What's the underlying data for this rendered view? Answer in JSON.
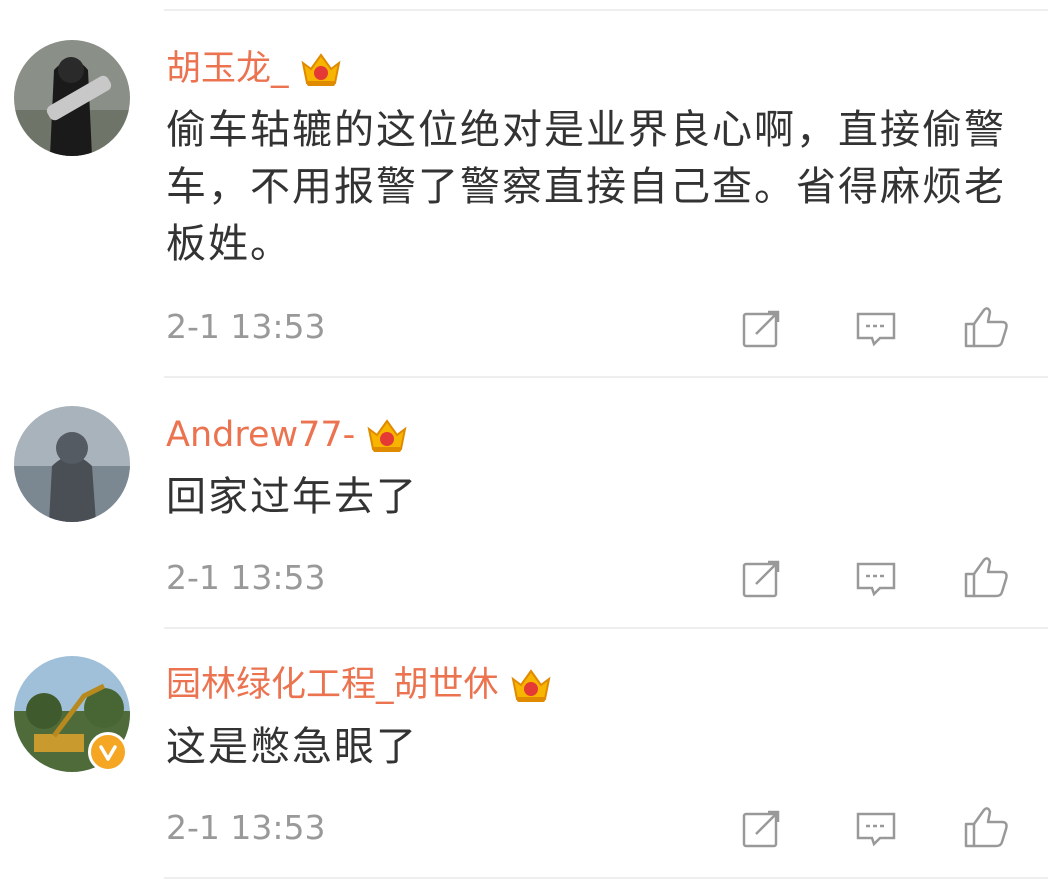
{
  "comments": [
    {
      "username": "胡玉龙_",
      "text": "偷车轱辘的这位绝对是业界良心啊，直接偷警车，不用报警了警察直接自己查。省得麻烦老板姓。",
      "timestamp": "2-1 13:53",
      "vip_icon": "crown-vip-icon",
      "avatar_icon": "avatar-woman-black-outfit"
    },
    {
      "username": "Andrew77-",
      "text": "回家过年去了",
      "timestamp": "2-1 13:53",
      "vip_icon": "crown-vip-icon",
      "avatar_icon": "avatar-hooded-person-sea"
    },
    {
      "username": "园林绿化工程_胡世休",
      "text": "这是憋急眼了",
      "timestamp": "2-1 13:53",
      "vip_icon": "crown-vip-icon",
      "avatar_icon": "avatar-construction-excavator",
      "verified": true
    }
  ],
  "actions": {
    "repost_icon": "repost-icon",
    "comment_icon": "comment-icon",
    "like_icon": "thumbs-up-icon"
  },
  "colors": {
    "username": "#eb7350",
    "text": "#333333",
    "meta": "#999999",
    "icon": "#999999",
    "divider": "#eeeeee",
    "badge": "#f5a623",
    "crown": "#f7b500"
  }
}
